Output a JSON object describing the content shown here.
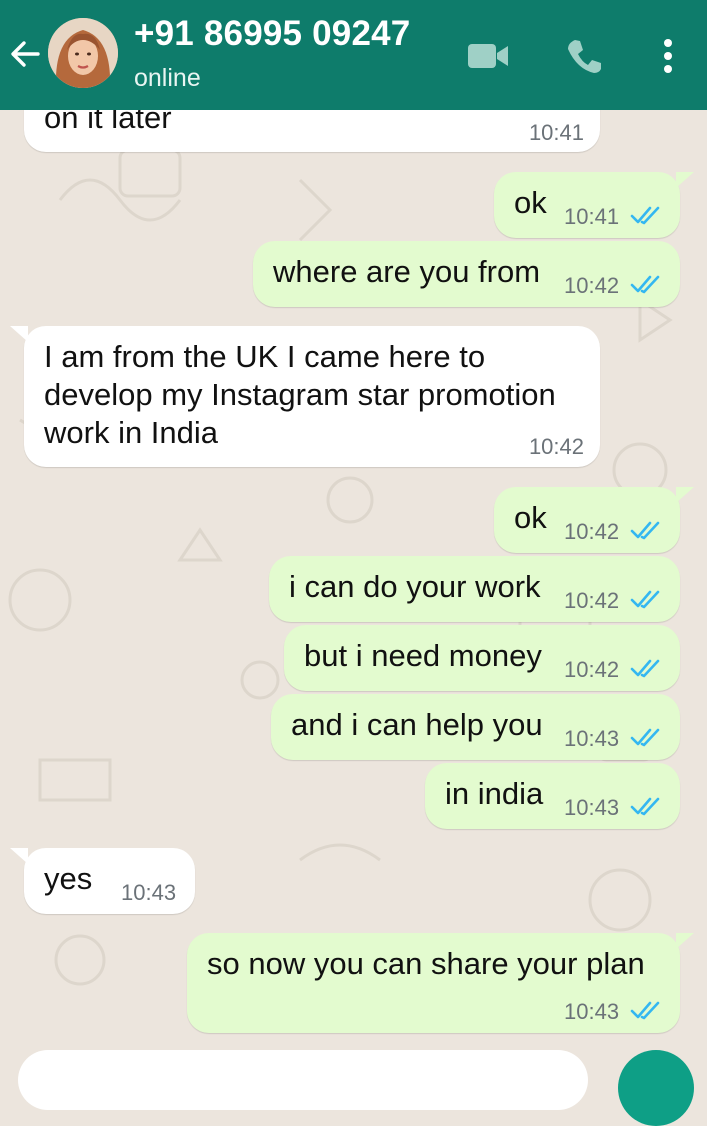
{
  "colors": {
    "header": "#0e7c6b",
    "incoming_bubble": "#ffffff",
    "outgoing_bubble": "#e3fbcf",
    "read_ticks": "#34b7f1",
    "background": "#ece5dd"
  },
  "header": {
    "contact_name": "+91 86995 09247",
    "status": "online",
    "icons": [
      "back-arrow-icon",
      "video-call-icon",
      "voice-call-icon",
      "more-options-icon"
    ]
  },
  "messages": [
    {
      "dir": "in",
      "text": "on it later",
      "time": "10:41"
    },
    {
      "dir": "out",
      "text": "ok",
      "time": "10:41",
      "status": "read"
    },
    {
      "dir": "out",
      "text": "where are you from",
      "time": "10:42",
      "status": "read"
    },
    {
      "dir": "in",
      "lines": [
        "I am from the UK I came here to",
        "develop my Instagram star promotion",
        "work in India"
      ],
      "time": "10:42"
    },
    {
      "dir": "out",
      "text": "ok",
      "time": "10:42",
      "status": "read"
    },
    {
      "dir": "out",
      "text": "i can do your work",
      "time": "10:42",
      "status": "read"
    },
    {
      "dir": "out",
      "text": "but i need money",
      "time": "10:42",
      "status": "read"
    },
    {
      "dir": "out",
      "text": "and i can help you",
      "time": "10:43",
      "status": "read"
    },
    {
      "dir": "out",
      "text": "in india",
      "time": "10:43",
      "status": "read"
    },
    {
      "dir": "in",
      "text": "yes",
      "time": "10:43"
    },
    {
      "dir": "out",
      "text": "so now you can share your plan",
      "time": "10:43",
      "status": "read"
    }
  ]
}
